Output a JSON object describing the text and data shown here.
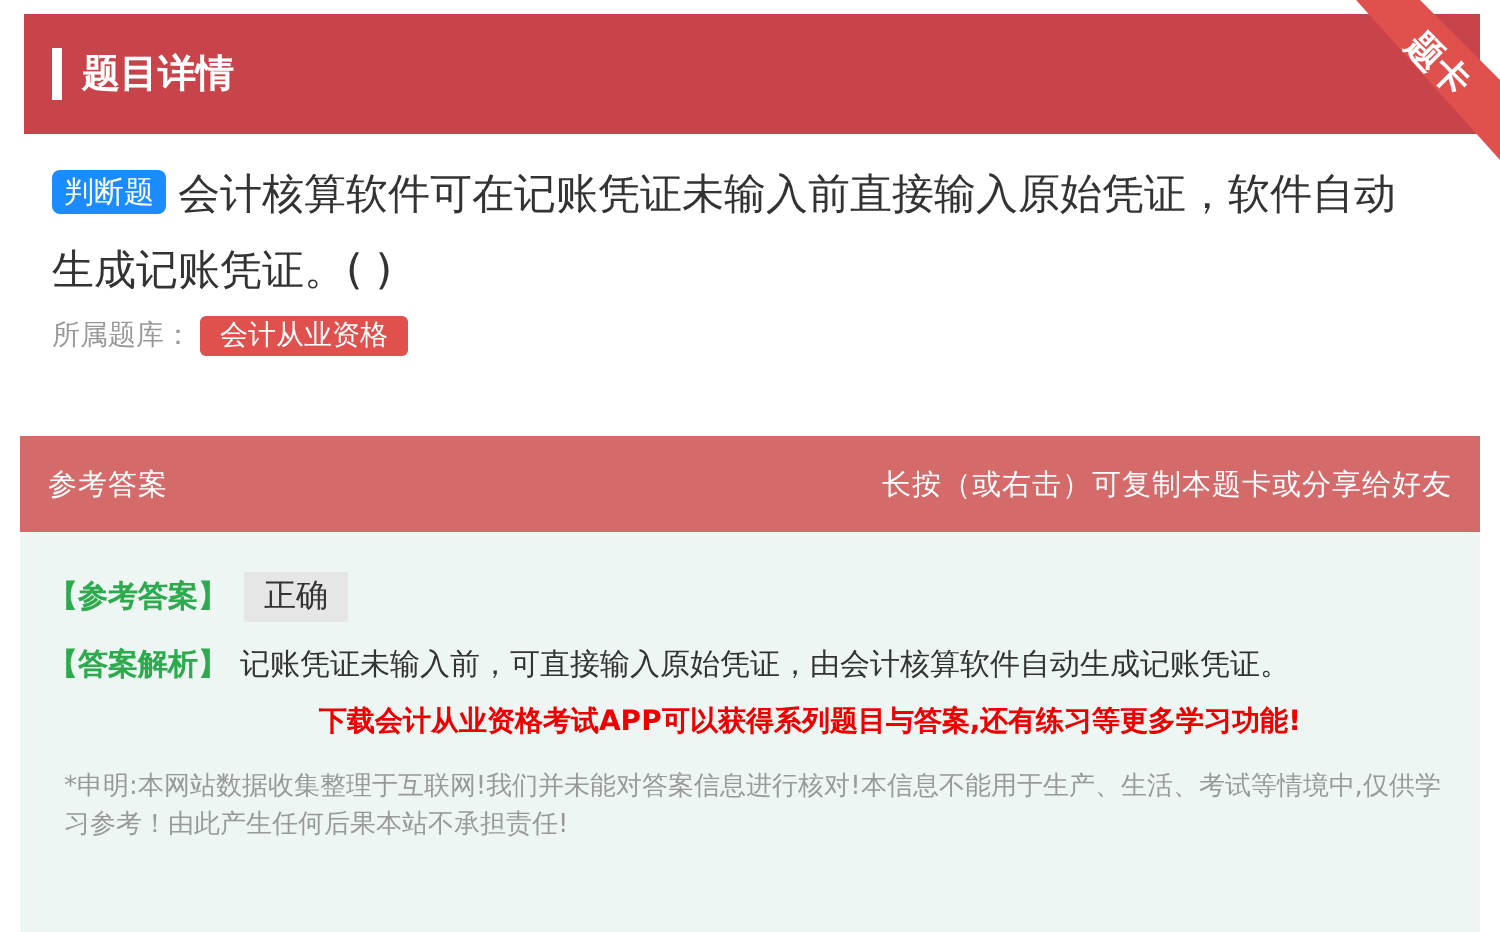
{
  "header": {
    "title": "题目详情",
    "ribbon": "题卡"
  },
  "question": {
    "type_tag": "判断题",
    "text": "会计核算软件可在记账凭证未输入前直接输入原始凭证，软件自动生成记账凭证。( )",
    "source_label": "所属题库：",
    "source_tag": "会计从业资格"
  },
  "answer_section": {
    "title": "参考答案",
    "hint": "长按（或右击）可复制本题卡或分享给好友",
    "answer_label": "【参考答案】",
    "answer": "正确",
    "analysis_label": "【答案解析】",
    "analysis": "记账凭证未输入前，可直接输入原始凭证，由会计核算软件自动生成记账凭证。",
    "promo": "下载会计从业资格考试APP可以获得系列题目与答案,还有练习等更多学习功能!",
    "disclaimer": "*申明:本网站数据收集整理于互联网!我们并未能对答案信息进行核对!本信息不能用于生产、生活、考试等情境中,仅供学习参考！由此产生任何后果本站不承担责任!"
  }
}
